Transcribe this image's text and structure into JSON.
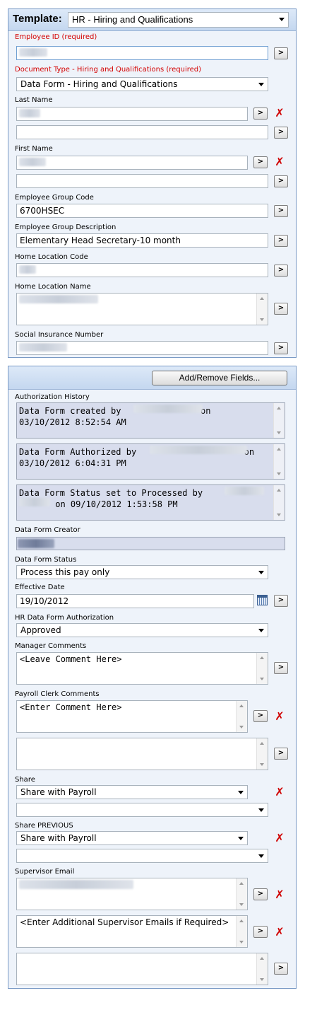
{
  "template": {
    "label": "Template:",
    "value": "HR - Hiring and Qualifications"
  },
  "fields": {
    "employee_id": {
      "label": "Employee ID (required)",
      "value": ""
    },
    "document_type": {
      "label": "Document Type - Hiring and Qualifications (required)",
      "value": "Data Form - Hiring and Qualifications"
    },
    "last_name": {
      "label": "Last Name",
      "value": ""
    },
    "first_name": {
      "label": "First Name",
      "value": ""
    },
    "employee_group_code": {
      "label": "Employee Group Code",
      "value": "6700HSEC"
    },
    "employee_group_description": {
      "label": "Employee Group Description",
      "value": "Elementary Head Secretary-10 month"
    },
    "home_location_code": {
      "label": "Home Location Code",
      "value": ""
    },
    "home_location_name": {
      "label": "Home Location Name",
      "value": ""
    },
    "social_insurance_number": {
      "label": "Social Insurance Number",
      "value": ""
    }
  },
  "add_remove_button": "Add/Remove Fields...",
  "authorization_history": {
    "label": "Authorization History",
    "entries": [
      {
        "prefix": "Data Form created by",
        "suffix": "on",
        "date": "03/10/2012 8:52:54 AM"
      },
      {
        "prefix": "Data Form Authorized by",
        "suffix": "on",
        "date": "03/10/2012 6:04:31 PM"
      },
      {
        "prefix": "Data Form Status set to Processed by",
        "suffix": "on 09/10/2012 1:53:58 PM"
      }
    ]
  },
  "form2": {
    "creator": {
      "label": "Data Form Creator"
    },
    "status": {
      "label": "Data Form Status",
      "value": "Process this pay only"
    },
    "effective_date": {
      "label": "Effective Date",
      "value": "19/10/2012"
    },
    "hr_auth": {
      "label": "HR Data Form Authorization",
      "value": "Approved"
    },
    "manager_comments": {
      "label": "Manager Comments",
      "value": "<Leave Comment Here>"
    },
    "payroll_comments": {
      "label": "Payroll Clerk Comments",
      "value": "<Enter Comment Here>"
    },
    "share": {
      "label": "Share",
      "value": "Share with Payroll"
    },
    "share_previous": {
      "label": "Share PREVIOUS",
      "value": "Share with Payroll"
    },
    "supervisor_email": {
      "label": "Supervisor Email",
      "additional": "<Enter Additional Supervisor Emails if Required>"
    }
  },
  "icons": {
    "goto": ">",
    "delete": "✗",
    "calendar": "calendar-icon"
  },
  "colors": {
    "panel_border": "#7a9ac5",
    "panel_bg": "#eef3fa",
    "header_bg": "#c9dbf1",
    "required": "#d40000",
    "delete": "#d00000",
    "history_bg": "#d8dded"
  }
}
